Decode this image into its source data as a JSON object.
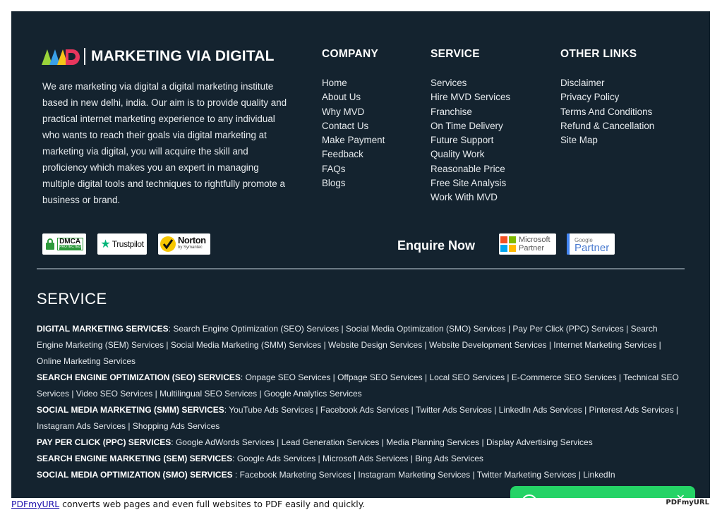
{
  "brand": {
    "name": "MARKETING VIA DIGITAL"
  },
  "about": "We are marketing via digital a digital marketing institute based in new delhi, india. Our aim is to provide quality and practical internet marketing experience to any individual who wants to reach their goals via digital marketing at marketing via digital, you will acquire the skill and proficiency which makes you an expert in managing multiple digital tools and techniques to rightfully promote a business or brand.",
  "columns": {
    "company": {
      "title": "COMPANY",
      "items": [
        "Home",
        "About Us",
        "Why MVD",
        "Contact Us",
        "Make Payment",
        "Feedback",
        "FAQs",
        "Blogs"
      ]
    },
    "service": {
      "title": "SERVICE",
      "items": [
        "Services",
        "Hire MVD Services",
        "Franchise",
        "On Time Delivery",
        "Future Support",
        "Quality Work",
        "Reasonable Price",
        "Free Site Analysis",
        "Work With MVD"
      ]
    },
    "other": {
      "title": "OTHER LINKS",
      "items": [
        "Disclaimer",
        "Privacy Policy",
        "Terms And Conditions",
        "Refund & Cancellation",
        "Site Map"
      ]
    }
  },
  "badges": {
    "dmca": {
      "line1": "DMCA",
      "line2": "PROTECTED"
    },
    "trustpilot": "Trustpilot",
    "norton": {
      "line1": "Norton",
      "line2": "by Symantec"
    },
    "microsoft": {
      "line1": "Microsoft",
      "line2": "Partner"
    },
    "google": {
      "line1": "Google",
      "line2": "Partner"
    }
  },
  "enquire": "Enquire Now",
  "services_section": {
    "title": "SERVICE",
    "groups": [
      {
        "heading": "DIGITAL MARKETING SERVICES",
        "text": ": Search Engine Optimization (SEO) Services | Social Media Optimization (SMO) Services | Pay Per Click (PPC) Services | Search Engine Marketing (SEM) Services | Social Media Marketing (SMM) Services | Website Design Services | Website Development Services | Internet Marketing Services | Online Marketing Services"
      },
      {
        "heading": "SEARCH ENGINE OPTIMIZATION (SEO) SERVICES",
        "text": ": Onpage SEO Services | Offpage SEO Services | Local SEO Services | E-Commerce SEO Services | Technical SEO Services | Video SEO Services | Multilingual SEO Services | Google Analytics Services"
      },
      {
        "heading": "SOCIAL MEDIA MARKETING (SMM) SERVICES",
        "text": ": YouTube Ads Services | Facebook Ads Services | Twitter Ads Services | LinkedIn Ads Services | Pinterest Ads Services | Instagram Ads Services | Shopping Ads Services"
      },
      {
        "heading": "PAY PER CLICK (PPC) SERVICES",
        "text": ": Google AdWords Services | Lead Generation Services | Media Planning Services | Display Advertising Services"
      },
      {
        "heading": "SEARCH ENGINE MARKETING (SEM) SERVICES",
        "text": ": Google Ads Services | Microsoft Ads Services | Bing Ads Services"
      },
      {
        "heading": "SOCIAL MEDIA OPTIMIZATION (SMO) SERVICES",
        "text": " : Facebook Marketing Services | Instagram Marketing Services | Twitter Marketing Services | LinkedIn"
      }
    ]
  },
  "footer": {
    "link": "PDFmyURL",
    "text": " converts web pages and even full websites to PDF easily and quickly.",
    "logo": "PDFmyURL"
  },
  "colors": {
    "background": "#14232f",
    "whatsapp": "#25d366"
  }
}
